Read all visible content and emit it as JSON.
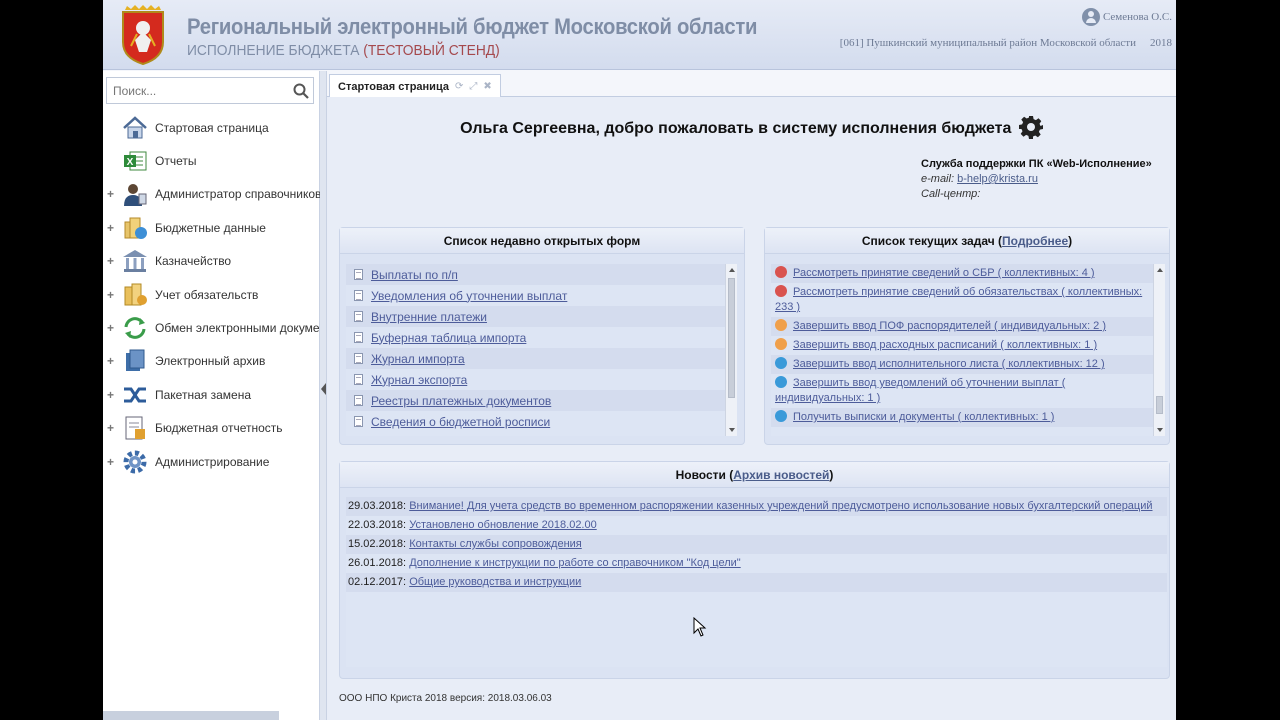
{
  "header": {
    "title": "Региональный электронный бюджет Московской области",
    "subtitle_main": "ИСПОЛНЕНИЕ БЮДЖЕТА",
    "subtitle_test": "(ТЕСТОВЫЙ СТЕНД)",
    "user": "Семенова О.С.",
    "org": "[061] Пушкинский муниципальный район Московской области",
    "year": "2018"
  },
  "sidebar": {
    "search_placeholder": "Поиск...",
    "items": [
      {
        "label": "Стартовая страница",
        "expandable": false,
        "icon": "home-icon"
      },
      {
        "label": "Отчеты",
        "expandable": false,
        "icon": "excel-report-icon"
      },
      {
        "label": "Администратор справочников",
        "expandable": true,
        "icon": "admin-user-icon"
      },
      {
        "label": "Бюджетные данные",
        "expandable": true,
        "icon": "budget-data-icon"
      },
      {
        "label": "Казначейство",
        "expandable": true,
        "icon": "treasury-icon"
      },
      {
        "label": "Учет обязательств",
        "expandable": true,
        "icon": "obligations-icon"
      },
      {
        "label": "Обмен электронными документами",
        "expandable": true,
        "icon": "exchange-icon"
      },
      {
        "label": "Электронный архив",
        "expandable": true,
        "icon": "archive-icon"
      },
      {
        "label": "Пакетная замена",
        "expandable": true,
        "icon": "batch-replace-icon"
      },
      {
        "label": "Бюджетная отчетность",
        "expandable": true,
        "icon": "budget-reporting-icon"
      },
      {
        "label": "Администрирование",
        "expandable": true,
        "icon": "settings-icon"
      }
    ]
  },
  "tabs": {
    "active": "Стартовая страница",
    "tools": [
      "refresh-icon",
      "expand-icon",
      "close-icon"
    ]
  },
  "welcome": {
    "text": "Ольга Сергеевна, добро пожаловать в систему исполнения бюджета"
  },
  "support": {
    "title": "Служба поддержки ПК «Web-Исполнение»",
    "email_label": "e-mail:",
    "email": "b-help@krista.ru",
    "callcenter_label": "Call-центр:"
  },
  "recent": {
    "title": "Список недавно открытых форм",
    "items": [
      "Выплаты по п/п",
      "Уведомления об уточнении выплат",
      "Внутренние платежи",
      "Буферная таблица импорта",
      "Журнал импорта",
      "Журнал экспорта",
      "Реестры платежных документов",
      "Сведения о бюджетной росписи"
    ]
  },
  "tasks": {
    "title": "Список текущих задач",
    "more_link": "Подробнее",
    "items": [
      {
        "text": "Рассмотреть принятие сведений о СБР ( коллективных: 4 )",
        "color": "#d9534f"
      },
      {
        "text": "Рассмотреть принятие сведений об обязательствах ( коллективных: 233 )",
        "color": "#d9534f"
      },
      {
        "text": "Завершить ввод ПОФ распорядителей ( индивидуальных: 2 )",
        "color": "#f0a04b"
      },
      {
        "text": "Завершить ввод расходных расписаний ( коллективных: 1 )",
        "color": "#f0a04b"
      },
      {
        "text": "Завершить ввод исполнительного листа ( коллективных: 12 )",
        "color": "#3a9ad9"
      },
      {
        "text": "Завершить ввод уведомлений об уточнении выплат ( индивидуальных: 1 )",
        "color": "#3a9ad9"
      },
      {
        "text": "Получить выписки и документы ( коллективных: 1 )",
        "color": "#3a9ad9"
      }
    ]
  },
  "news": {
    "title": "Новости",
    "archive_link": "Архив новостей",
    "items": [
      {
        "date": "29.03.2018:",
        "text": "Внимание! Для учета средств во временном распоряжении казенных учреждений предусмотрено использование новых бухгалтерский операций"
      },
      {
        "date": "22.03.2018:",
        "text": "Установлено обновление 2018.02.00"
      },
      {
        "date": "15.02.2018:",
        "text": "Контакты службы сопровождения"
      },
      {
        "date": "26.01.2018:",
        "text": "Дополнение к инструкции по работе со справочником \"Код цели\""
      },
      {
        "date": "02.12.2017:",
        "text": "Общие руководства и инструкции"
      }
    ]
  },
  "footer": {
    "text": "ООО НПО Криста 2018 версия: 2018.03.06.03"
  }
}
